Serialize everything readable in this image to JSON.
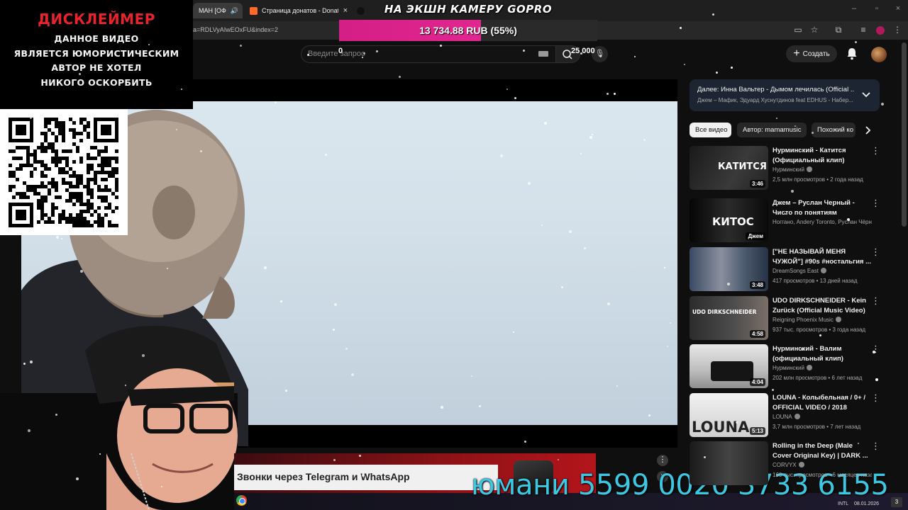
{
  "colors": {
    "page_bg": "#0f0f0f",
    "disclaimer_title": "#e8232b",
    "goal_fill": "#d41f86",
    "card_number": "#3cc8e2",
    "next_card_bg": "#1c2531"
  },
  "browser": {
    "tabs": [
      {
        "label": "МАН [ОФ",
        "icon": "speaker-icon",
        "active": true
      },
      {
        "label": "Страница донатов - Donation",
        "icon": "donationalerts-icon",
        "active": false
      }
    ],
    "url": "a=RDLVyAIwEOxFU&index=2",
    "toolbar_icons": [
      "cast-icon",
      "star-icon",
      "extensions-icon",
      "playlist-icon",
      "profile-icon",
      "menu-icon"
    ]
  },
  "youtube": {
    "search_placeholder": "Введите запрос",
    "create_label": "Создать",
    "icons": [
      "keyboard-icon",
      "search-icon",
      "mic-icon",
      "plus-icon",
      "bell-icon",
      "avatar-icon"
    ]
  },
  "overlay": {
    "disclaimer_title": "ДИСКЛЕЙМЕР",
    "disclaimer_lines": [
      "ДАННОЕ ВИДЕО",
      "ЯВЛЯЕТСЯ ЮМОРИСТИЧЕСКИМ",
      "АВТОР НЕ ХОТЕЛ",
      "НИКОГО ОСКОРБИТЬ"
    ],
    "goal_title": "НА ЭКШН КАМЕРУ GOPRO",
    "goal_amount": "13 734.88 RUB (55%)",
    "goal_progress": 0.55,
    "goal_min": "0",
    "goal_max": "25 000",
    "card_number": "юмани 5599 0020 3733 6155",
    "ad_title": "Звонки через Telegram и WhatsApp"
  },
  "taskbar": {
    "lang": "INTL",
    "date": "08.01.2026",
    "notif_count": "3"
  },
  "sidebar": {
    "up_next_title": "Далее: Инна Вальтер - Дымом лечилась (Official ...",
    "up_next_sub": "Джем – Мафик, Эдуард Хуснутдинов feat EDHUS - Набер...",
    "chips": [
      "Все видео",
      "Автор: mamamusic",
      "Похожий ко"
    ],
    "recommendations": [
      {
        "title": "Нурминский - Катится (Официальный клип)",
        "channel": "Нурминский",
        "meta": "2,5 млн просмотров • 2 года назад",
        "duration": "3:46",
        "thumb_text": "КАТИТСЯ"
      },
      {
        "title": "Джем – Руслан Черный - Чисто по понятиям",
        "channel": "Ноггано, Andery Toronto, Руслан Чёрн...",
        "meta": "",
        "duration": "Джем",
        "thumb_text": "КИТОС"
      },
      {
        "title": "[\"НЕ НАЗЫВАЙ МЕНЯ ЧУЖОЙ\"] #90s #ностальгия ...",
        "channel": "DreamSongs East",
        "meta": "417 просмотров • 13 дней назад",
        "duration": "3:48",
        "thumb_text": ""
      },
      {
        "title": "UDO DIRKSCHNEIDER - Kein Zurück (Official Music Video)",
        "channel": "Reigning Phoenix Music",
        "meta": "937 тыс. просмотров • 3 года назад",
        "duration": "4:58",
        "thumb_text": "UDO DIRKSCHNEIDER"
      },
      {
        "title": "Нурминский - Валим (официальный клип)",
        "channel": "Нурминский",
        "meta": "202 млн просмотров • 6 лет назад",
        "duration": "4:04",
        "thumb_text": ""
      },
      {
        "title": "LOUNA - Колыбельная / 0+ / OFFICIAL VIDEO / 2018",
        "channel": "LOUNA",
        "meta": "3,7 млн просмотров • 7 лет назад",
        "duration": "5:13",
        "thumb_text": "LOUNA"
      },
      {
        "title": "Rolling in the Deep (Male Cover Original Key) | DARK ...",
        "channel": "CORVYX",
        "meta": "160 тыс. просмотров • 6 месяцев назад",
        "duration": "",
        "thumb_text": ""
      }
    ]
  }
}
